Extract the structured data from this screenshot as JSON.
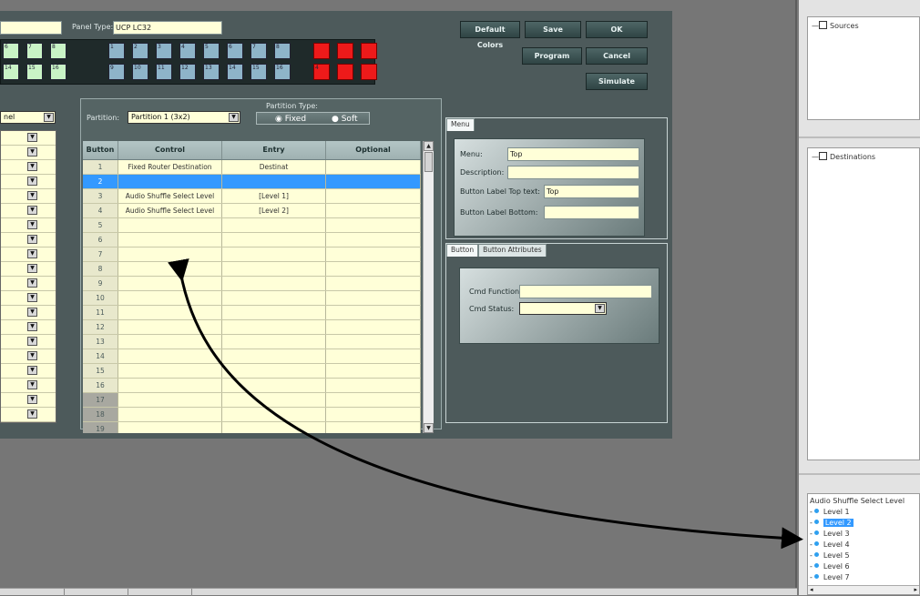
{
  "header": {
    "panel_type_label": "Panel Type:",
    "panel_type_value": "UCP LC32",
    "name_value": "",
    "buttons": {
      "default_colors": "Default Colors",
      "save": "Save",
      "ok": "OK",
      "program": "Program",
      "cancel": "Cancel",
      "simulate": "Simulate"
    }
  },
  "panel_grid_left": {
    "row1": [
      "6",
      "7",
      "8"
    ],
    "row2": [
      "14",
      "15",
      "16"
    ]
  },
  "panel_grid_middle": {
    "row1": [
      "1",
      "2",
      "3",
      "4",
      "5",
      "6",
      "7",
      "8"
    ],
    "row2": [
      "9",
      "10",
      "11",
      "12",
      "13",
      "14",
      "15",
      "16"
    ]
  },
  "panel_grid_red": {
    "row1": [
      "",
      "",
      ""
    ],
    "row2": [
      "4",
      "",
      ""
    ]
  },
  "left_partial": {
    "dropdown_text": "nel"
  },
  "partition": {
    "label": "Partition:",
    "value": "Partition 1 (3x2)",
    "type_label": "Partition Type:",
    "type_options": [
      "Fixed",
      "Soft"
    ],
    "type_selected": "Fixed"
  },
  "grid": {
    "columns": [
      "Button",
      "Control",
      "Entry",
      "Optional"
    ],
    "rows": [
      {
        "button": "1",
        "control": "Fixed Router Destination",
        "entry": "Destinat",
        "optional": ""
      },
      {
        "button": "2",
        "control": "",
        "entry": "",
        "optional": ""
      },
      {
        "button": "3",
        "control": "Audio Shuffle Select Level",
        "entry": "[Level 1]",
        "optional": ""
      },
      {
        "button": "4",
        "control": "Audio Shuffle Select Level",
        "entry": "[Level 2]",
        "optional": ""
      },
      {
        "button": "5",
        "control": "",
        "entry": "",
        "optional": ""
      },
      {
        "button": "6",
        "control": "",
        "entry": "",
        "optional": ""
      },
      {
        "button": "7",
        "control": "",
        "entry": "",
        "optional": ""
      },
      {
        "button": "8",
        "control": "",
        "entry": "",
        "optional": ""
      },
      {
        "button": "9",
        "control": "",
        "entry": "",
        "optional": ""
      },
      {
        "button": "10",
        "control": "",
        "entry": "",
        "optional": ""
      },
      {
        "button": "11",
        "control": "",
        "entry": "",
        "optional": ""
      },
      {
        "button": "12",
        "control": "",
        "entry": "",
        "optional": ""
      },
      {
        "button": "13",
        "control": "",
        "entry": "",
        "optional": ""
      },
      {
        "button": "14",
        "control": "",
        "entry": "",
        "optional": ""
      },
      {
        "button": "15",
        "control": "",
        "entry": "",
        "optional": ""
      },
      {
        "button": "16",
        "control": "",
        "entry": "",
        "optional": ""
      },
      {
        "button": "17",
        "control": "",
        "entry": "",
        "optional": ""
      },
      {
        "button": "18",
        "control": "",
        "entry": "",
        "optional": ""
      },
      {
        "button": "19",
        "control": "",
        "entry": "",
        "optional": ""
      }
    ],
    "selected_row": "2"
  },
  "menu_panel": {
    "tab": "Menu",
    "menu_label": "Menu:",
    "menu_value": "Top",
    "description_label": "Description:",
    "description_value": "",
    "label_top_label": "Button Label Top text:",
    "label_top_value": "Top",
    "label_bottom_label": "Button Label Bottom:",
    "label_bottom_value": ""
  },
  "button_panel": {
    "tabs": [
      "Button",
      "Button Attributes"
    ],
    "cmd_function_label": "Cmd Function:",
    "cmd_function_value": "",
    "cmd_status_label": "Cmd Status:",
    "cmd_status_value": ""
  },
  "sidebar": {
    "sources_label": "Sources",
    "destinations_label": "Destinations",
    "levels_tree": {
      "root": "Audio Shuffle Select Level",
      "items": [
        "Level 1",
        "Level 2",
        "Level 3",
        "Level 4",
        "Level 5",
        "Level 6",
        "Level 7"
      ],
      "selected": "Level 2"
    }
  },
  "colors": {
    "panel_bg": "#4d5a5b",
    "cell_bg": "#ffffd8",
    "selection": "#3399ff",
    "red_button": "#ee1a1a",
    "green_button": "#c9f3c6",
    "blue_button": "#8eb4c9"
  }
}
